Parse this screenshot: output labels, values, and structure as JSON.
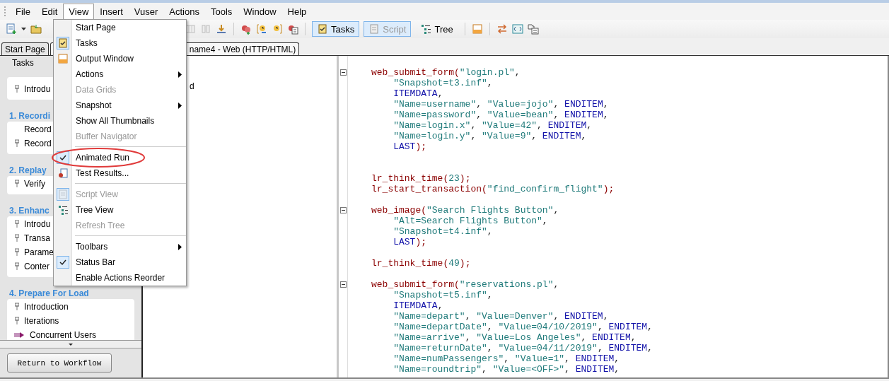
{
  "menu_bar": [
    {
      "label": "File",
      "selected": false
    },
    {
      "label": "Edit",
      "selected": false
    },
    {
      "label": "View",
      "selected": true
    },
    {
      "label": "Insert",
      "selected": false
    },
    {
      "label": "Vuser",
      "selected": false
    },
    {
      "label": "Actions",
      "selected": false
    },
    {
      "label": "Tools",
      "selected": false
    },
    {
      "label": "Window",
      "selected": false
    },
    {
      "label": "Help",
      "selected": false
    }
  ],
  "toolbar": {
    "buttons": [
      {
        "label": "Tasks",
        "pressed": true,
        "disabled": false
      },
      {
        "label": "Script",
        "pressed": true,
        "disabled": true
      },
      {
        "label": "Tree",
        "pressed": false,
        "disabled": false
      }
    ]
  },
  "tabs": [
    {
      "label": "Start Page",
      "selected": false
    },
    {
      "label": "name4 - Web (HTTP/HTML)",
      "selected": true
    }
  ],
  "view_menu": {
    "items": [
      {
        "kind": "item",
        "label": "Start Page",
        "checked": false,
        "disabled": false,
        "submenu": false,
        "circled": false
      },
      {
        "kind": "item",
        "label": "Tasks",
        "checked": true,
        "disabled": false,
        "submenu": false,
        "circled": false
      },
      {
        "kind": "item",
        "label": "Output Window",
        "checked": false,
        "disabled": false,
        "submenu": false,
        "circled": false
      },
      {
        "kind": "item",
        "label": "Actions",
        "checked": false,
        "disabled": false,
        "submenu": true,
        "circled": false
      },
      {
        "kind": "item",
        "label": "Data Grids",
        "checked": false,
        "disabled": true,
        "submenu": false,
        "circled": false
      },
      {
        "kind": "item",
        "label": "Snapshot",
        "checked": false,
        "disabled": false,
        "submenu": true,
        "circled": false
      },
      {
        "kind": "item",
        "label": "Show All Thumbnails",
        "checked": false,
        "disabled": false,
        "submenu": false,
        "circled": false
      },
      {
        "kind": "item",
        "label": "Buffer Navigator",
        "checked": false,
        "disabled": true,
        "submenu": false,
        "circled": false
      },
      {
        "kind": "separator"
      },
      {
        "kind": "item",
        "label": "Animated Run",
        "checked": true,
        "disabled": false,
        "submenu": false,
        "circled": true
      },
      {
        "kind": "item",
        "label": "Test Results...",
        "checked": false,
        "disabled": false,
        "submenu": false,
        "circled": false
      },
      {
        "kind": "separator"
      },
      {
        "kind": "item",
        "label": "Script View",
        "checked": true,
        "disabled": true,
        "submenu": false,
        "circled": false
      },
      {
        "kind": "item",
        "label": "Tree View",
        "checked": false,
        "disabled": false,
        "submenu": false,
        "circled": false
      },
      {
        "kind": "item",
        "label": "Refresh Tree",
        "checked": false,
        "disabled": true,
        "submenu": false,
        "circled": false
      },
      {
        "kind": "separator"
      },
      {
        "kind": "item",
        "label": "Toolbars",
        "checked": false,
        "disabled": false,
        "submenu": true,
        "circled": false
      },
      {
        "kind": "item",
        "label": "Status Bar",
        "checked": true,
        "disabled": false,
        "submenu": false,
        "circled": false
      },
      {
        "kind": "item",
        "label": "Enable Actions Reorder",
        "checked": false,
        "disabled": false,
        "submenu": false,
        "circled": false
      }
    ]
  },
  "task_pane": {
    "header": "Tasks",
    "sections": [
      {
        "items": [
          {
            "kind": "pin",
            "label": "Introdu"
          }
        ]
      },
      {
        "title": "1. Recordi",
        "items": [
          {
            "kind": "plain",
            "label": "Record"
          },
          {
            "kind": "pin",
            "label": "Record"
          }
        ]
      },
      {
        "title": "2. Replay",
        "items": [
          {
            "kind": "pin",
            "label": "Verify"
          }
        ]
      },
      {
        "title": "3. Enhanc",
        "items": [
          {
            "kind": "pin",
            "label": "Introdu"
          },
          {
            "kind": "pin",
            "label": "Transa"
          },
          {
            "kind": "pin",
            "label": "Parame"
          },
          {
            "kind": "pin",
            "label": "Conter"
          }
        ]
      },
      {
        "title": "4. Prepare For Load",
        "items": [
          {
            "kind": "pin",
            "label": "Introduction"
          },
          {
            "kind": "pin",
            "label": "Iterations"
          },
          {
            "kind": "current",
            "label": "Concurrent Users"
          }
        ]
      }
    ],
    "button": "Return to Workflow"
  },
  "tree_pane": {
    "text": "d"
  },
  "editor": {
    "lines": [
      {
        "kind": "head",
        "fold": true,
        "tokens": [
          {
            "kind": "fn",
            "text": "web_submit_form("
          },
          {
            "kind": "str",
            "text": "\"login.pl\""
          },
          {
            "kind": "p",
            "text": ","
          }
        ]
      },
      {
        "kind": "cont",
        "fold": false,
        "tokens": [
          {
            "kind": "str",
            "text": "\"Snapshot=t3.inf\""
          },
          {
            "kind": "p",
            "text": ","
          }
        ]
      },
      {
        "kind": "cont",
        "fold": false,
        "tokens": [
          {
            "kind": "kw",
            "text": "ITEMDATA"
          },
          {
            "kind": "p",
            "text": ","
          }
        ]
      },
      {
        "kind": "cont",
        "fold": false,
        "tokens": [
          {
            "kind": "str",
            "text": "\"Name=username\""
          },
          {
            "kind": "p",
            "text": ", "
          },
          {
            "kind": "str",
            "text": "\"Value=jojo\""
          },
          {
            "kind": "p",
            "text": ", "
          },
          {
            "kind": "kw",
            "text": "ENDITEM"
          },
          {
            "kind": "p",
            "text": ","
          }
        ]
      },
      {
        "kind": "cont",
        "fold": false,
        "tokens": [
          {
            "kind": "str",
            "text": "\"Name=password\""
          },
          {
            "kind": "p",
            "text": ", "
          },
          {
            "kind": "str",
            "text": "\"Value=bean\""
          },
          {
            "kind": "p",
            "text": ", "
          },
          {
            "kind": "kw",
            "text": "ENDITEM"
          },
          {
            "kind": "p",
            "text": ","
          }
        ]
      },
      {
        "kind": "cont",
        "fold": false,
        "tokens": [
          {
            "kind": "str",
            "text": "\"Name=login.x\""
          },
          {
            "kind": "p",
            "text": ", "
          },
          {
            "kind": "str",
            "text": "\"Value=42\""
          },
          {
            "kind": "p",
            "text": ", "
          },
          {
            "kind": "kw",
            "text": "ENDITEM"
          },
          {
            "kind": "p",
            "text": ","
          }
        ]
      },
      {
        "kind": "cont",
        "fold": false,
        "tokens": [
          {
            "kind": "str",
            "text": "\"Name=login.y\""
          },
          {
            "kind": "p",
            "text": ", "
          },
          {
            "kind": "str",
            "text": "\"Value=9\""
          },
          {
            "kind": "p",
            "text": ", "
          },
          {
            "kind": "kw",
            "text": "ENDITEM"
          },
          {
            "kind": "p",
            "text": ","
          }
        ]
      },
      {
        "kind": "cont",
        "fold": false,
        "tokens": [
          {
            "kind": "kw",
            "text": "LAST"
          },
          {
            "kind": "fn",
            "text": ");"
          }
        ]
      },
      {
        "kind": "blank"
      },
      {
        "kind": "blank"
      },
      {
        "kind": "head",
        "fold": false,
        "tokens": [
          {
            "kind": "fn",
            "text": "lr_think_time("
          },
          {
            "kind": "str",
            "text": "23"
          },
          {
            "kind": "fn",
            "text": ");"
          }
        ]
      },
      {
        "kind": "head",
        "fold": false,
        "tokens": [
          {
            "kind": "fn",
            "text": "lr_start_transaction("
          },
          {
            "kind": "str",
            "text": "\"find_confirm_flight\""
          },
          {
            "kind": "fn",
            "text": ");"
          }
        ]
      },
      {
        "kind": "blank"
      },
      {
        "kind": "head",
        "fold": true,
        "tokens": [
          {
            "kind": "fn",
            "text": "web_image("
          },
          {
            "kind": "str",
            "text": "\"Search Flights Button\""
          },
          {
            "kind": "p",
            "text": ","
          }
        ]
      },
      {
        "kind": "cont",
        "fold": false,
        "tokens": [
          {
            "kind": "str",
            "text": "\"Alt=Search Flights Button\""
          },
          {
            "kind": "p",
            "text": ","
          }
        ]
      },
      {
        "kind": "cont",
        "fold": false,
        "tokens": [
          {
            "kind": "str",
            "text": "\"Snapshot=t4.inf\""
          },
          {
            "kind": "p",
            "text": ","
          }
        ]
      },
      {
        "kind": "cont",
        "fold": false,
        "tokens": [
          {
            "kind": "kw",
            "text": "LAST"
          },
          {
            "kind": "fn",
            "text": ");"
          }
        ]
      },
      {
        "kind": "blank"
      },
      {
        "kind": "head",
        "fold": false,
        "tokens": [
          {
            "kind": "fn",
            "text": "lr_think_time("
          },
          {
            "kind": "str",
            "text": "49"
          },
          {
            "kind": "fn",
            "text": ");"
          }
        ]
      },
      {
        "kind": "blank"
      },
      {
        "kind": "head",
        "fold": true,
        "tokens": [
          {
            "kind": "fn",
            "text": "web_submit_form("
          },
          {
            "kind": "str",
            "text": "\"reservations.pl\""
          },
          {
            "kind": "p",
            "text": ","
          }
        ]
      },
      {
        "kind": "cont",
        "fold": false,
        "tokens": [
          {
            "kind": "str",
            "text": "\"Snapshot=t5.inf\""
          },
          {
            "kind": "p",
            "text": ","
          }
        ]
      },
      {
        "kind": "cont",
        "fold": false,
        "tokens": [
          {
            "kind": "kw",
            "text": "ITEMDATA"
          },
          {
            "kind": "p",
            "text": ","
          }
        ]
      },
      {
        "kind": "cont",
        "fold": false,
        "tokens": [
          {
            "kind": "str",
            "text": "\"Name=depart\""
          },
          {
            "kind": "p",
            "text": ", "
          },
          {
            "kind": "str",
            "text": "\"Value=Denver\""
          },
          {
            "kind": "p",
            "text": ", "
          },
          {
            "kind": "kw",
            "text": "ENDITEM"
          },
          {
            "kind": "p",
            "text": ","
          }
        ]
      },
      {
        "kind": "cont",
        "fold": false,
        "tokens": [
          {
            "kind": "str",
            "text": "\"Name=departDate\""
          },
          {
            "kind": "p",
            "text": ", "
          },
          {
            "kind": "str",
            "text": "\"Value=04/10/2019\""
          },
          {
            "kind": "p",
            "text": ", "
          },
          {
            "kind": "kw",
            "text": "ENDITEM"
          },
          {
            "kind": "p",
            "text": ","
          }
        ]
      },
      {
        "kind": "cont",
        "fold": false,
        "tokens": [
          {
            "kind": "str",
            "text": "\"Name=arrive\""
          },
          {
            "kind": "p",
            "text": ", "
          },
          {
            "kind": "str",
            "text": "\"Value=Los Angeles\""
          },
          {
            "kind": "p",
            "text": ", "
          },
          {
            "kind": "kw",
            "text": "ENDITEM"
          },
          {
            "kind": "p",
            "text": ","
          }
        ]
      },
      {
        "kind": "cont",
        "fold": false,
        "tokens": [
          {
            "kind": "str",
            "text": "\"Name=returnDate\""
          },
          {
            "kind": "p",
            "text": ", "
          },
          {
            "kind": "str",
            "text": "\"Value=04/11/2019\""
          },
          {
            "kind": "p",
            "text": ", "
          },
          {
            "kind": "kw",
            "text": "ENDITEM"
          },
          {
            "kind": "p",
            "text": ","
          }
        ]
      },
      {
        "kind": "cont",
        "fold": false,
        "tokens": [
          {
            "kind": "str",
            "text": "\"Name=numPassengers\""
          },
          {
            "kind": "p",
            "text": ", "
          },
          {
            "kind": "str",
            "text": "\"Value=1\""
          },
          {
            "kind": "p",
            "text": ", "
          },
          {
            "kind": "kw",
            "text": "ENDITEM"
          },
          {
            "kind": "p",
            "text": ","
          }
        ]
      },
      {
        "kind": "cont",
        "fold": false,
        "tokens": [
          {
            "kind": "str",
            "text": "\"Name=roundtrip\""
          },
          {
            "kind": "p",
            "text": ", "
          },
          {
            "kind": "str",
            "text": "\"Value=<OFF>\""
          },
          {
            "kind": "p",
            "text": ", "
          },
          {
            "kind": "kw",
            "text": "ENDITEM"
          },
          {
            "kind": "p",
            "text": ","
          }
        ]
      }
    ]
  }
}
